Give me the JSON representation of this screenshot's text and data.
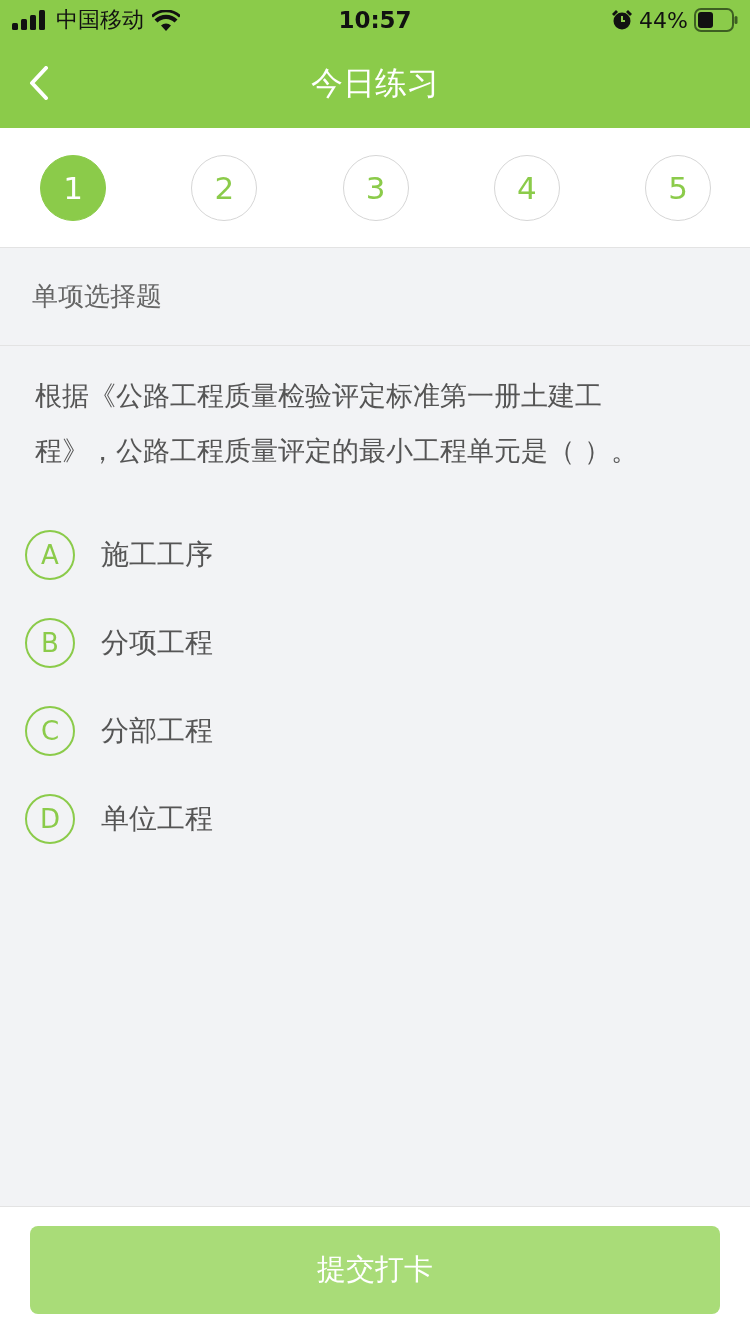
{
  "status_bar": {
    "carrier": "中国移动",
    "time": "10:57",
    "battery": "44%"
  },
  "nav": {
    "title": "今日练习"
  },
  "steps": [
    {
      "label": "1",
      "selected": true
    },
    {
      "label": "2",
      "selected": false
    },
    {
      "label": "3",
      "selected": false
    },
    {
      "label": "4",
      "selected": false
    },
    {
      "label": "5",
      "selected": false
    }
  ],
  "section": {
    "title": "单项选择题"
  },
  "question": {
    "text": "根据《公路工程质量检验评定标准第一册土建工程》，公路工程质量评定的最小工程单元是（    ）。",
    "options": [
      {
        "letter": "A",
        "text": "施工工序",
        "selected": false
      },
      {
        "letter": "B",
        "text": "分项工程",
        "selected": false
      },
      {
        "letter": "C",
        "text": "分部工程",
        "selected": false
      },
      {
        "letter": "D",
        "text": "单位工程",
        "selected": false
      }
    ]
  },
  "submit": {
    "label": "提交打卡",
    "disabled": true
  }
}
